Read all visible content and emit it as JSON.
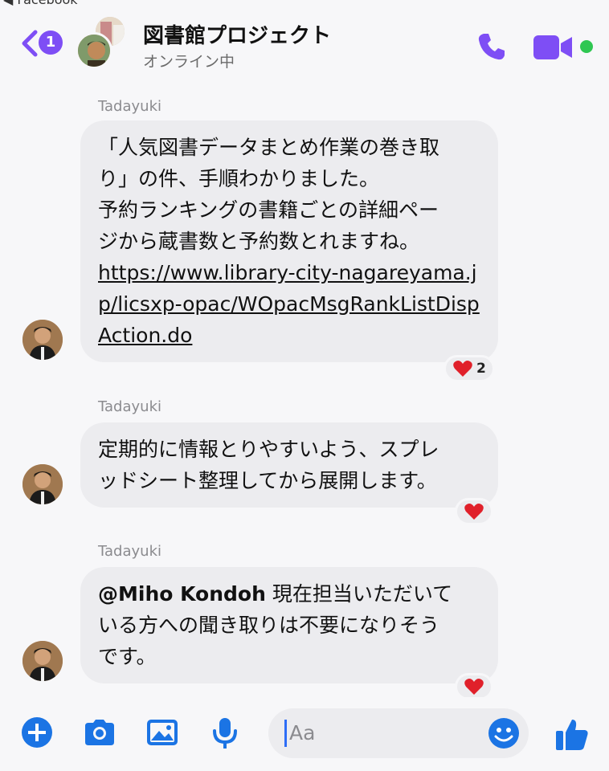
{
  "statusbar": {
    "back_app": "◀ Facebook"
  },
  "header": {
    "unread_count": "1",
    "title": "図書館プロジェクト",
    "subtitle": "オンライン中"
  },
  "messages": [
    {
      "sender": "Tadayuki",
      "lines": [
        "「人気図書データまとめ作業の巻き取",
        "り」の件、手順わかりました。",
        "予約ランキングの書籍ごとの詳細ペー",
        "ジから蔵書数と予約数とれますね。"
      ],
      "link": "https://www.library-city-nagareyama.jp/licsxp-opac/WOpacMsgRankListDispAction.do",
      "reaction": "2"
    },
    {
      "sender": "Tadayuki",
      "lines": [
        "定期的に情報とりやすいよう、スプレ",
        "ッドシート整理してから展開します。"
      ],
      "reaction": ""
    },
    {
      "sender": "Tadayuki",
      "mention": "@Miho Kondoh",
      "after_mention": " 現在担当いただいて",
      "lines": [
        "いる方への聞き取りは不要になりそう",
        "です。"
      ],
      "reaction": ""
    }
  ],
  "composer": {
    "placeholder": "Aa"
  },
  "colors": {
    "accent": "#7e4ef5",
    "composer_blue": "#1b74e4",
    "online": "#2fc752",
    "heart": "#e0202a"
  }
}
